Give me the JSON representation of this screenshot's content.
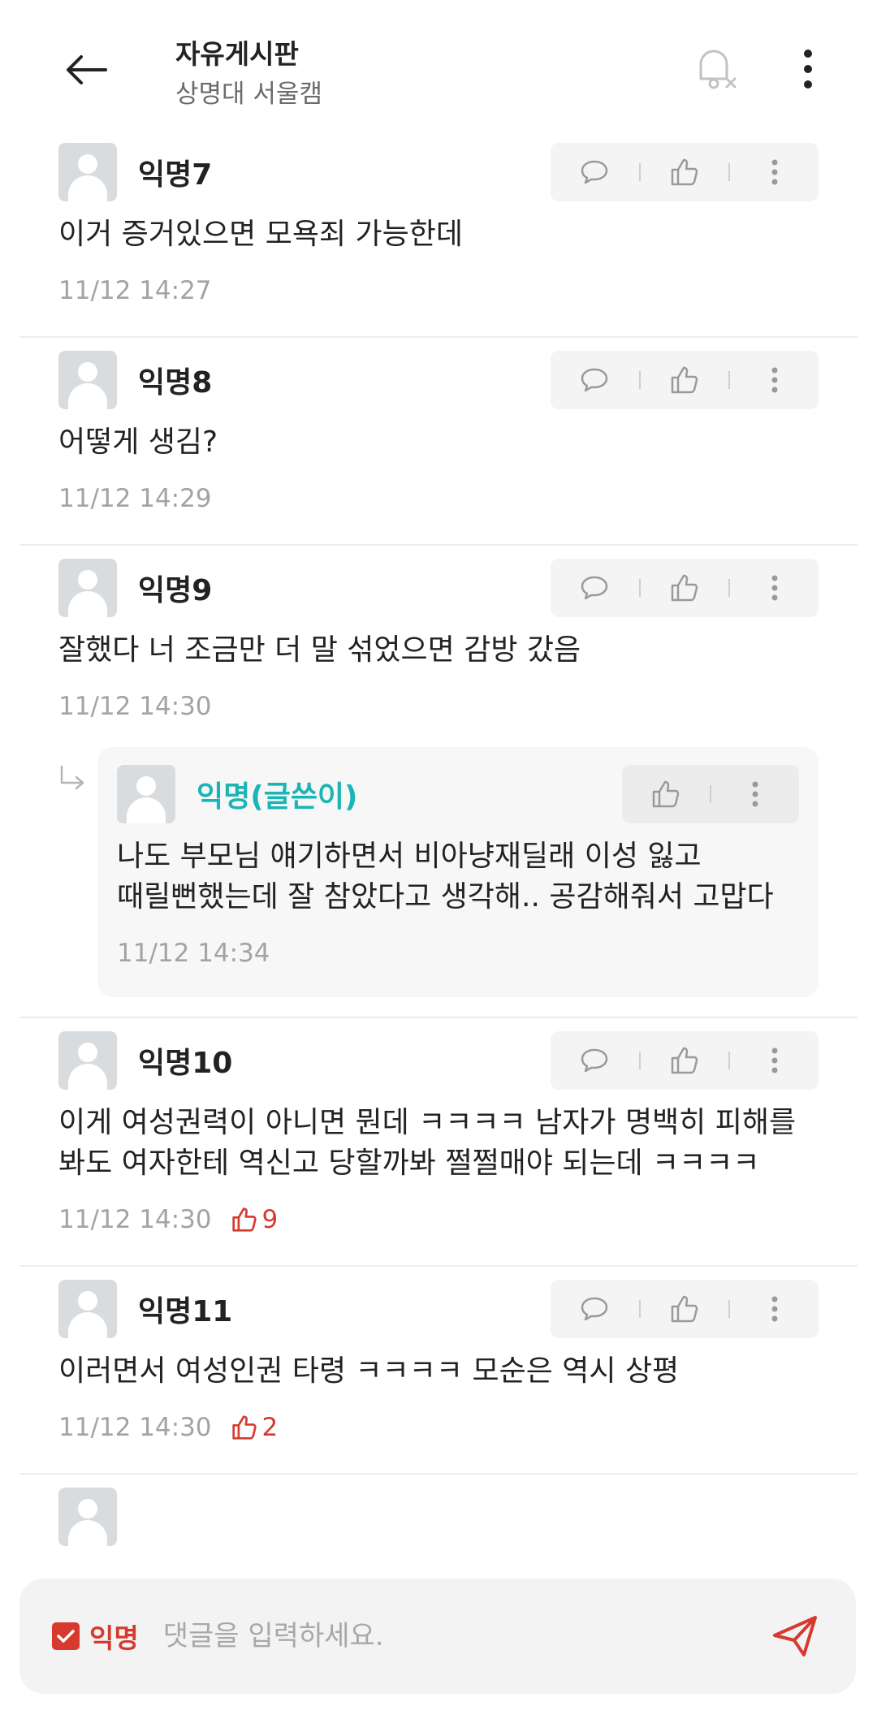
{
  "header": {
    "title": "자유게시판",
    "subtitle": "상명대 서울캠"
  },
  "colors": {
    "accent_red": "#d63a2f",
    "author_teal": "#1bb5b5",
    "meta_gray": "#a3a3a3"
  },
  "icons": {
    "back": "arrow-left-icon",
    "bell": "bell-off-icon",
    "more": "more-vertical-icon",
    "comment": "speech-bubble-icon",
    "like": "thumbs-up-icon",
    "send": "paper-plane-icon",
    "reply": "reply-arrow-icon"
  },
  "comments": [
    {
      "nick": "익명7",
      "body": "이거 증거있으면 모욕죄 가능한데",
      "time": "11/12 14:27"
    },
    {
      "nick": "익명8",
      "body": "어떻게 생김?",
      "time": "11/12 14:29"
    },
    {
      "nick": "익명9",
      "body": "잘했다 너 조금만 더 말 섞었으면 감방 갔음",
      "time": "11/12 14:30",
      "reply": {
        "nick": "익명(글쓴이)",
        "body": "나도 부모님 얘기하면서 비아냥재딜래 이성 잃고 때릴뻔했는데 잘 참았다고 생각해.. 공감해줘서 고맙다",
        "time": "11/12 14:34"
      }
    },
    {
      "nick": "익명10",
      "body": "이게 여성권력이 아니면 뭔데 ㅋㅋㅋㅋ 남자가 명백히 피해를 봐도 여자한테 역신고 당할까봐 쩔쩔매야 되는데 ㅋㅋㅋㅋ",
      "time": "11/12 14:30",
      "votes": "9"
    },
    {
      "nick": "익명11",
      "body": "이러면서 여성인권 타령 ㅋㅋㅋㅋ 모순은 역시 상평",
      "time": "11/12 14:30",
      "votes": "2"
    }
  ],
  "footer": {
    "anon_label": "익명",
    "anon_checked": true,
    "placeholder": "댓글을 입력하세요."
  }
}
